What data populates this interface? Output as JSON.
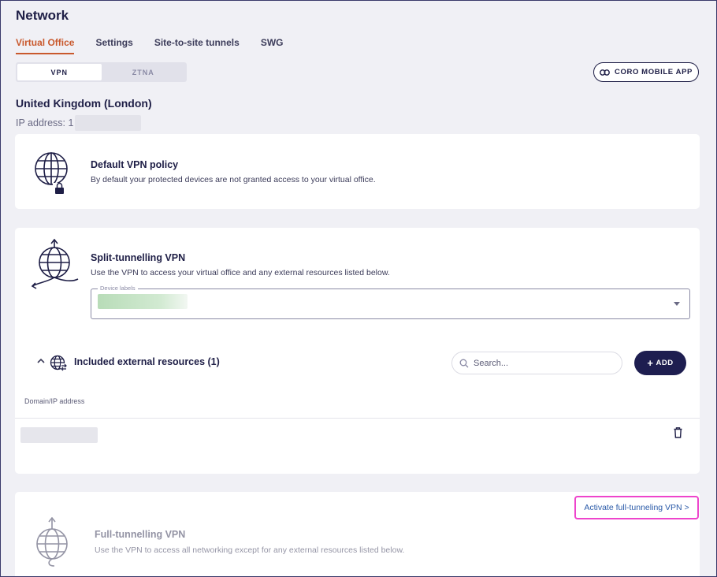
{
  "page": {
    "title": "Network"
  },
  "tabs": [
    {
      "label": "Virtual Office",
      "active": true
    },
    {
      "label": "Settings"
    },
    {
      "label": "Site-to-site tunnels"
    },
    {
      "label": "SWG"
    }
  ],
  "mode_toggle": {
    "options": [
      "VPN",
      "ZTNA"
    ],
    "selected": "VPN"
  },
  "mobile_app_button": {
    "label": "CORO MOBILE APP",
    "icon": "link-icon"
  },
  "location": {
    "name": "United Kingdom (London)",
    "ip_label": "IP address: 1"
  },
  "default_policy": {
    "title": "Default VPN policy",
    "description": "By default your protected devices are not granted access to your virtual office.",
    "icon": "globe-lock-icon"
  },
  "split_tunnel": {
    "title": "Split-tunnelling VPN",
    "description": "Use the VPN to access your virtual office and any external resources listed below.",
    "icon": "globe-arrow-icon",
    "device_labels": {
      "label": "Device labels"
    },
    "resources": {
      "title": "Included external resources (1)",
      "search_placeholder": "Search...",
      "add_label": "ADD",
      "column_header": "Domain/IP address"
    }
  },
  "full_tunnel": {
    "title": "Full-tunnelling VPN",
    "description": "Use the VPN to access all networking except for any external resources listed below.",
    "activate_label": "Activate full-tunneling VPN >",
    "highlight_color": "#ee44cc"
  },
  "colors": {
    "accent": "#c9592d",
    "primary": "#1e1e50",
    "link": "#2a5aa8"
  }
}
